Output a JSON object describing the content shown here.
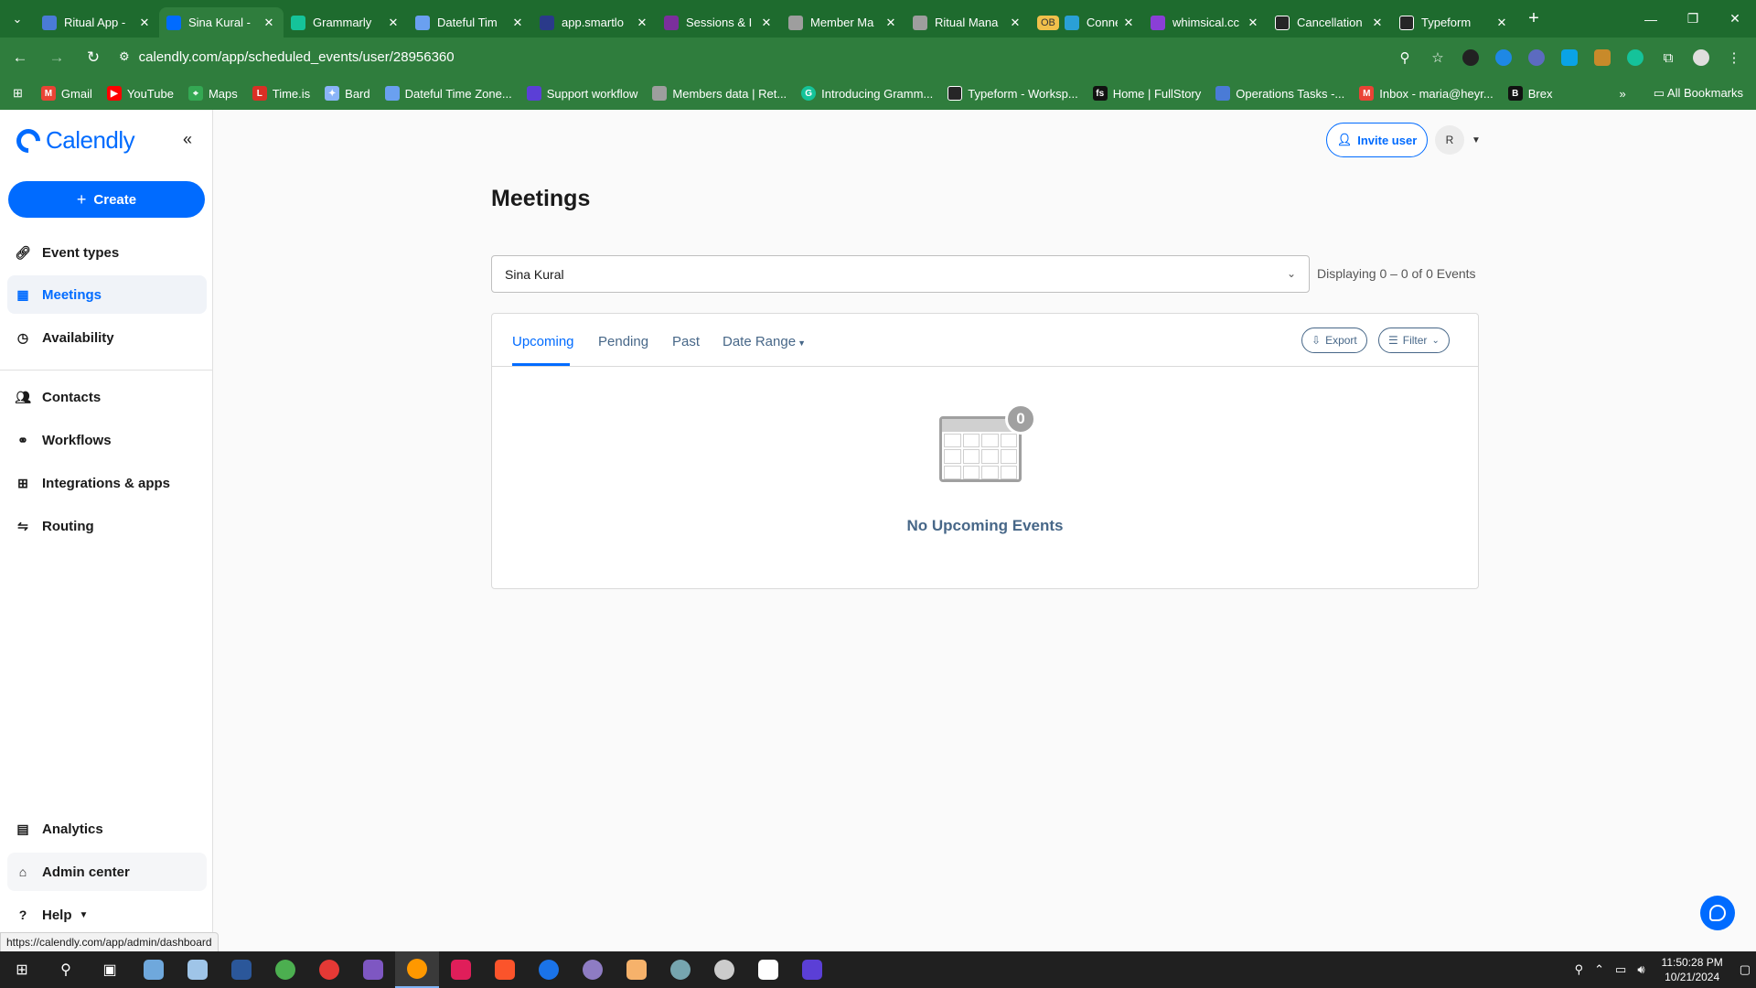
{
  "browser": {
    "tabs": [
      {
        "title": "Ritual App -",
        "color": "#4a7bd6",
        "active": false
      },
      {
        "title": "Sina Kural -",
        "color": "#006bff",
        "active": true
      },
      {
        "title": "Grammarly",
        "color": "#15c39a",
        "active": false
      },
      {
        "title": "Dateful Tim",
        "color": "#6aa0f0",
        "active": false
      },
      {
        "title": "app.smartlo",
        "color": "#2a3a8a",
        "active": false
      },
      {
        "title": "Sessions & I",
        "color": "#7b2f9c",
        "active": false
      },
      {
        "title": "Member Ma",
        "color": "#9e9e9e",
        "active": false
      },
      {
        "title": "Ritual Mana",
        "color": "#9e9e9e",
        "active": false
      },
      {
        "title": "Connectean",
        "color": "#2aa0d6",
        "active": false,
        "badge": "OB"
      },
      {
        "title": "whimsical.cc",
        "color": "#8a3fd6",
        "active": false
      },
      {
        "title": "Cancellation",
        "color": "#262627",
        "active": false
      },
      {
        "title": "Typeform",
        "color": "#262627",
        "active": false
      }
    ],
    "url": "calendly.com/app/scheduled_events/user/28956360",
    "bookmarks": [
      {
        "label": "Gmail",
        "color": "#ea4335"
      },
      {
        "label": "YouTube",
        "color": "#ff0000"
      },
      {
        "label": "Maps",
        "color": "#34a853"
      },
      {
        "label": "Time.is",
        "color": "#d93025"
      },
      {
        "label": "Bard",
        "color": "#8ab4f8"
      },
      {
        "label": "Dateful Time Zone...",
        "color": "#6aa0f0"
      },
      {
        "label": "Support workflow",
        "color": "#5b3fd6"
      },
      {
        "label": "Members data | Ret...",
        "color": "#9e9e9e"
      },
      {
        "label": "Introducing Gramm...",
        "color": "#15c39a"
      },
      {
        "label": "Typeform - Worksp...",
        "color": "#262627"
      },
      {
        "label": "Home | FullStory",
        "color": "#111111"
      },
      {
        "label": "Operations Tasks -...",
        "color": "#4a7bd6"
      },
      {
        "label": "Inbox - maria@heyr...",
        "color": "#ea4335"
      },
      {
        "label": "Brex",
        "color": "#111111"
      }
    ],
    "all_bookmarks": "All Bookmarks",
    "status_url": "https://calendly.com/app/admin/dashboard"
  },
  "app": {
    "logo": "Calendly",
    "create_label": "Create",
    "nav": [
      {
        "label": "Event types",
        "icon": "link-icon"
      },
      {
        "label": "Meetings",
        "icon": "calendar-icon",
        "active": true
      },
      {
        "label": "Availability",
        "icon": "clock-icon"
      },
      {
        "label": "Contacts",
        "icon": "contacts-icon"
      },
      {
        "label": "Workflows",
        "icon": "workflow-icon"
      },
      {
        "label": "Integrations & apps",
        "icon": "grid-icon"
      },
      {
        "label": "Routing",
        "icon": "routing-icon"
      }
    ],
    "bottom_nav": [
      {
        "label": "Analytics",
        "icon": "chart-icon"
      },
      {
        "label": "Admin center",
        "icon": "admin-icon"
      },
      {
        "label": "Help",
        "icon": "help-icon"
      }
    ],
    "invite_label": "Invite user",
    "avatar_initial": "R"
  },
  "main": {
    "title": "Meetings",
    "user_filter": "Sina Kural",
    "displaying": "Displaying 0 – 0 of 0 Events",
    "tabs": [
      "Upcoming",
      "Pending",
      "Past",
      "Date Range"
    ],
    "export_label": "Export",
    "filter_label": "Filter",
    "empty_count": "0",
    "empty_text": "No Upcoming Events"
  },
  "taskbar": {
    "time": "11:50:28 PM",
    "date": "10/21/2024"
  }
}
